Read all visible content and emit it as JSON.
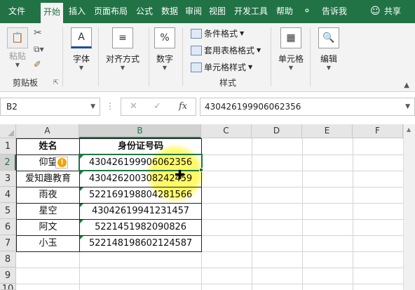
{
  "ribbon_tabs": {
    "file": "文件",
    "home": "开始",
    "insert": "插入",
    "page_layout": "页面布局",
    "formulas": "公式",
    "data": "数据",
    "review": "审阅",
    "view": "视图",
    "developer": "开发工具",
    "help": "帮助",
    "tell_me": "告诉我",
    "share": "共享"
  },
  "ribbon": {
    "paste_label": "粘贴",
    "clipboard_group": "剪贴板",
    "font_label": "字体",
    "alignment_label": "对齐方式",
    "number_label": "数字",
    "conditional_format": "条件格式",
    "table_format": "套用表格格式",
    "cell_styles": "单元格样式",
    "styles_group": "样式",
    "cells_label": "单元格",
    "editing_label": "编辑"
  },
  "formula_bar": {
    "name_box": "B2",
    "content": "430426199906062356"
  },
  "sheet": {
    "columns": [
      "A",
      "B",
      "C",
      "D",
      "E",
      "F"
    ],
    "rows": [
      "1",
      "2",
      "3",
      "4",
      "5",
      "6",
      "7",
      "8",
      "9",
      "10"
    ],
    "header_name": "姓名",
    "header_id": "身份证号码",
    "records": [
      {
        "name": "仰望",
        "id": "430426199906062356"
      },
      {
        "name": "爱知趣教育",
        "id": "430426200308242459"
      },
      {
        "name": "雨夜",
        "id": "522169198804281566"
      },
      {
        "name": "星空",
        "id": "43042619941231457"
      },
      {
        "name": "阿文",
        "id": "5221451982090826"
      },
      {
        "name": "小玉",
        "id": "522148198602124587"
      }
    ]
  },
  "colors": {
    "excel_green": "#217346",
    "highlight": "#fff35a",
    "warning": "#f0a500"
  }
}
